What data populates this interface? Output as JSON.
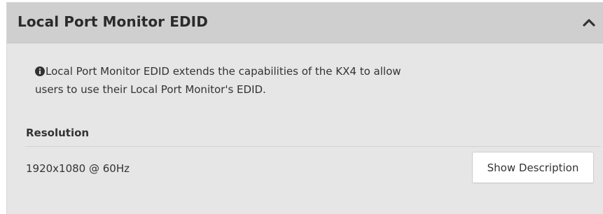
{
  "panel": {
    "title": "Local Port Monitor EDID",
    "toggle_icon": "chevron-up-icon"
  },
  "info": {
    "icon": "info-circle-icon",
    "text": "Local Port Monitor EDID extends the capabilities of the KX4 to allow users to use their Local Port Monitor's EDID."
  },
  "resolution": {
    "label": "Resolution",
    "value": "1920x1080 @ 60Hz",
    "button_label": "Show Description"
  },
  "colors": {
    "panel_background": "#e6e6e6",
    "header_background": "#cfcfcf",
    "text": "#333333"
  }
}
